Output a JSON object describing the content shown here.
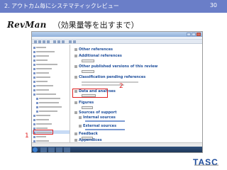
{
  "slide": {
    "header_title": "2. アウトカム毎にシステマティックレビュー",
    "page_number": "30",
    "subtitle_logo": "RevMan",
    "subtitle_text": "（効果量等を出すまで）",
    "callout_1": "1",
    "callout_2": "2",
    "company_logo": "TASC"
  },
  "screenshot": {
    "headings": [
      "Other references",
      "Additional references",
      "Other published versions of this review",
      "Classification pending references",
      "Data and analyses",
      "Figures",
      "Sources of support",
      "Internal sources",
      "External sources",
      "Feedback",
      "Appendices"
    ]
  },
  "colors": {
    "header_bar": "#6a7ec8",
    "callout_red": "#e02020",
    "heading_blue": "#1f4f9c",
    "logo_blue": "#1e4c9c"
  }
}
